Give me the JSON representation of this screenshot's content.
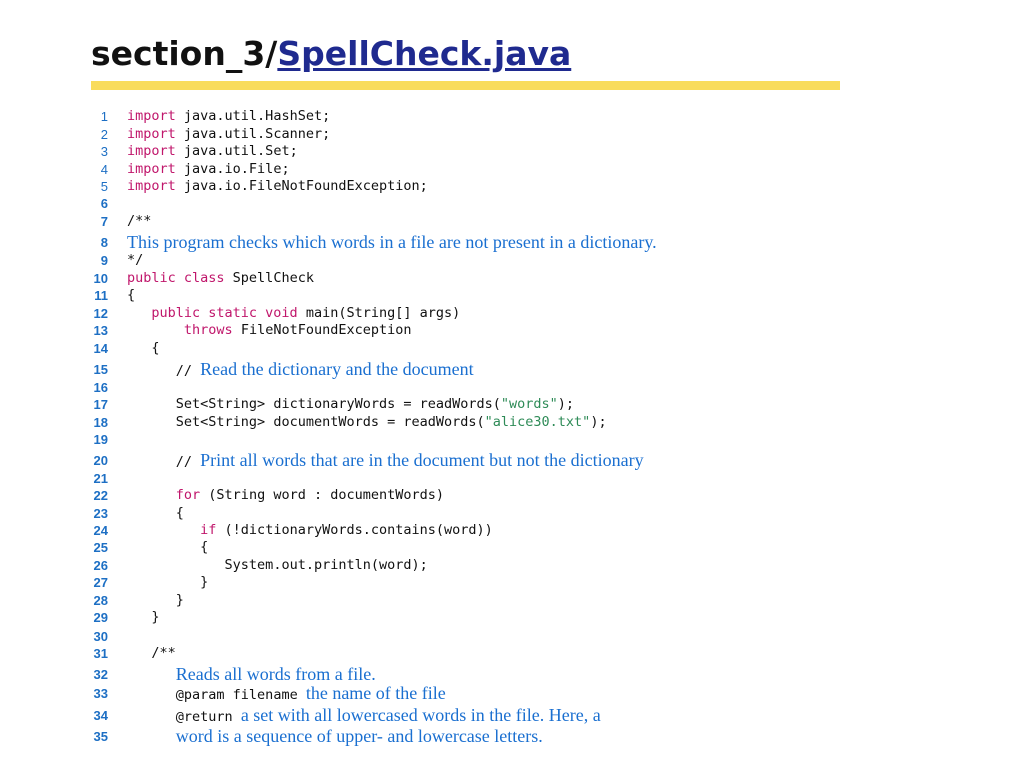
{
  "title": {
    "dir": "section_3/",
    "file": "SpellCheck.java"
  },
  "code": {
    "line_numbers": [
      "1",
      "2",
      "3",
      "4",
      "5",
      "6",
      "7",
      "8",
      "9",
      "10",
      "11",
      "12",
      "13",
      "14",
      "15",
      "16",
      "17",
      "18",
      "19",
      "20",
      "21",
      "22",
      "23",
      "24",
      "25",
      "26",
      "27",
      "28",
      "29",
      "30",
      "31",
      "32",
      "33",
      "34",
      "35"
    ],
    "l1": {
      "kw": "import",
      "text": " java.util.HashSet;"
    },
    "l2": {
      "kw": "import",
      "text": " java.util.Scanner;"
    },
    "l3": {
      "kw": "import",
      "text": " java.util.Set;"
    },
    "l4": {
      "kw": "import",
      "text": " java.io.File;"
    },
    "l5": {
      "kw": "import",
      "text": " java.io.FileNotFoundException;"
    },
    "l7": {
      "text": "/**"
    },
    "l8": {
      "comment": "This program checks which words in a file are not present in a dictionary."
    },
    "l9": {
      "text": "*/"
    },
    "l10": {
      "kw": "public class",
      "text": " SpellCheck"
    },
    "l11": {
      "text": "{"
    },
    "l12": {
      "indent": "   ",
      "kw": "public static void",
      "text": " main(String[] args)"
    },
    "l13": {
      "indent": "       ",
      "kw": "throws",
      "text": " FileNotFoundException"
    },
    "l14": {
      "indent": "   ",
      "text": "{"
    },
    "l15": {
      "indent": "      ",
      "text": "// ",
      "comment": "Read the dictionary and the document"
    },
    "l17": {
      "indent": "      ",
      "text": "Set<String> dictionaryWords = readWords(",
      "str": "\"words\"",
      "text2": ");"
    },
    "l18": {
      "indent": "      ",
      "text": "Set<String> documentWords = readWords(",
      "str": "\"alice30.txt\"",
      "text2": ");"
    },
    "l20": {
      "indent": "      ",
      "text": "// ",
      "comment": "Print all words that are in the document but not the dictionary"
    },
    "l22": {
      "indent": "      ",
      "kw": "for",
      "text": " (String word : documentWords)"
    },
    "l23": {
      "indent": "      ",
      "text": "{"
    },
    "l24": {
      "indent": "         ",
      "kw": "if",
      "text": " (!dictionaryWords.contains(word))"
    },
    "l25": {
      "indent": "         ",
      "text": "{"
    },
    "l26": {
      "indent": "            ",
      "text": "System.out.println(word);"
    },
    "l27": {
      "indent": "         ",
      "text": "}"
    },
    "l28": {
      "indent": "      ",
      "text": "}"
    },
    "l29": {
      "indent": "   ",
      "text": "}"
    },
    "l31": {
      "indent": "   ",
      "text": "/**"
    },
    "l32": {
      "indent": "      ",
      "comment": "Reads all words from a file."
    },
    "l33": {
      "indent": "      ",
      "text": "@param filename ",
      "comment": "the name of the file"
    },
    "l34": {
      "indent": "      ",
      "text": "@return ",
      "comment": "a set with all lowercased words in the file. Here, a"
    },
    "l35": {
      "indent": "      ",
      "comment": "word is a sequence of upper- and lowercase letters."
    }
  },
  "colors": {
    "keyword": "#c0166b",
    "string": "#2e8b57",
    "comment": "#1a6fd0",
    "line_number": "#1d6fc4",
    "title_link": "#1f2a8f",
    "title_underline": "#f9dc5c"
  }
}
